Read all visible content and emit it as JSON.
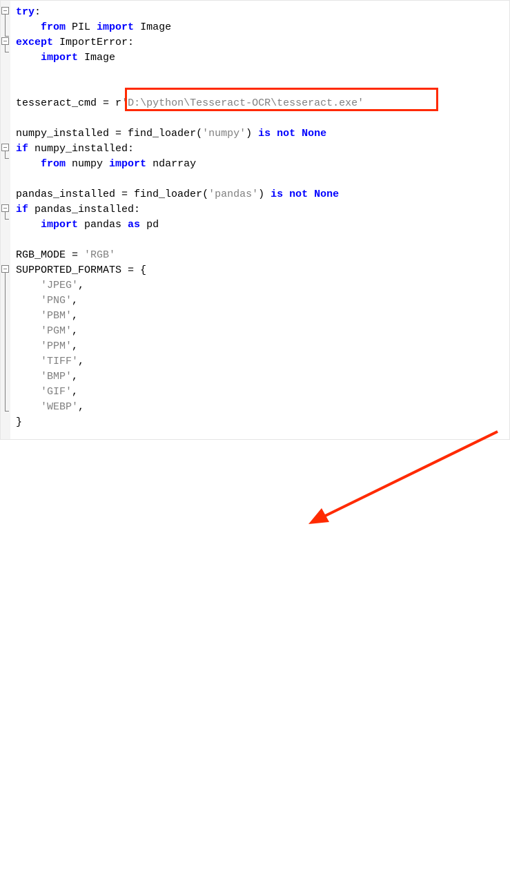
{
  "code": {
    "l1a": "try",
    "l1b": ":",
    "l2a": "from",
    "l2b": " PIL ",
    "l2c": "import",
    "l2d": " Image",
    "l3a": "except",
    "l3b": " ImportError:",
    "l4a": "import",
    "l4b": " Image",
    "l5a": "tesseract_cmd ",
    "l5b": "=",
    "l5c": " r",
    "l5d": "'D:\\python\\Tesseract-OCR\\tesseract.exe'",
    "l6a": "numpy_installed ",
    "l6b": "=",
    "l6c": " find_loader(",
    "l6d": "'numpy'",
    "l6e": ") ",
    "l6f": "is not None",
    "l7a": "if",
    "l7b": " numpy_installed:",
    "l8a": "from",
    "l8b": " numpy ",
    "l8c": "import",
    "l8d": " ndarray",
    "l9a": "pandas_installed ",
    "l9b": "=",
    "l9c": " find_loader(",
    "l9d": "'pandas'",
    "l9e": ") ",
    "l9f": "is not None",
    "l10a": "if",
    "l10b": " pandas_installed:",
    "l11a": "import",
    "l11b": " pandas ",
    "l11c": "as",
    "l11d": " pd",
    "l12a": "RGB_MODE ",
    "l12b": "=",
    "l12c": "'RGB'",
    "l13a": "SUPPORTED_FORMATS ",
    "l13b": "=",
    "l13c": " {",
    "f1": "'JPEG'",
    "f2": "'PNG'",
    "f3": "'PBM'",
    "f4": "'PGM'",
    "f5": "'PPM'",
    "f6": "'TIFF'",
    "f7": "'BMP'",
    "f8": "'GIF'",
    "f9": "'WEBP'",
    "cb": "}"
  },
  "annotation": {
    "highlight_target": "tesseract_cmd path string",
    "arrow_color": "#ff2a00"
  }
}
